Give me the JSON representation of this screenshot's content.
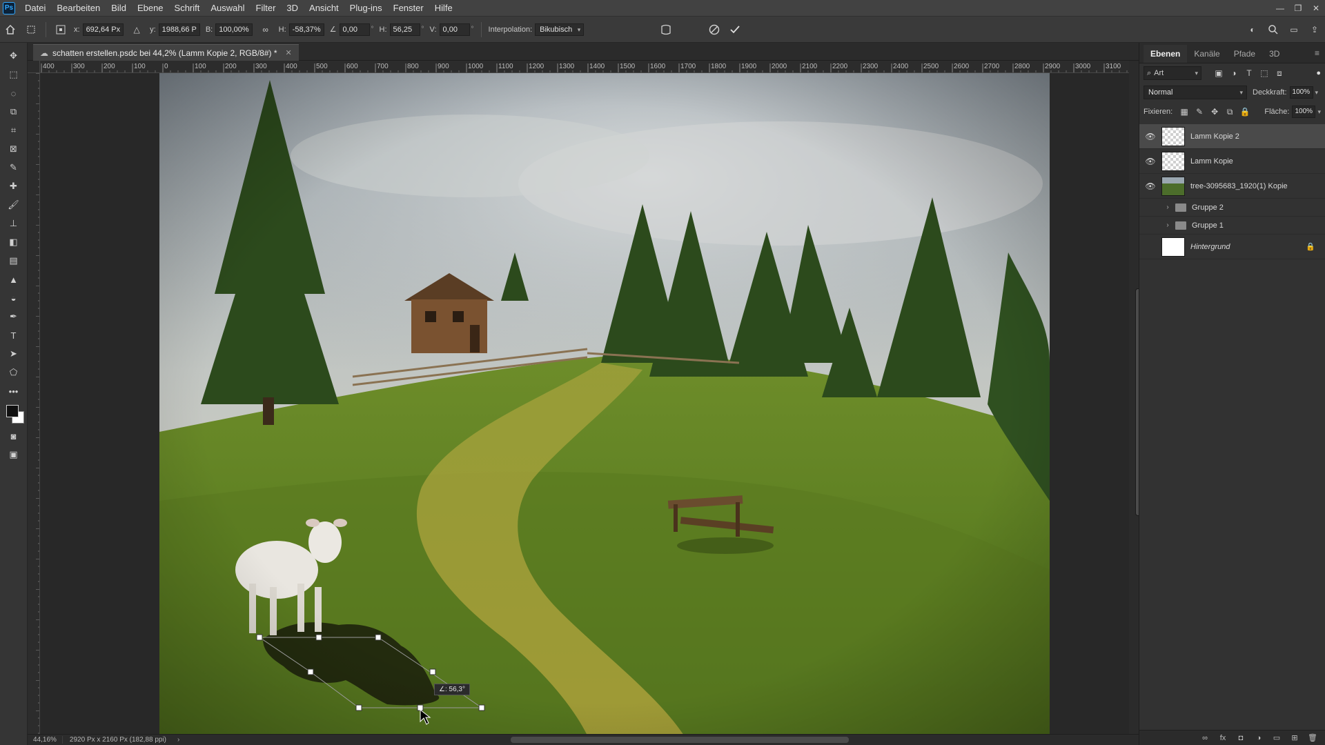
{
  "menubar": {
    "logo": "Ps",
    "items": [
      "Datei",
      "Bearbeiten",
      "Bild",
      "Ebene",
      "Schrift",
      "Auswahl",
      "Filter",
      "3D",
      "Ansicht",
      "Plug-ins",
      "Fenster",
      "Hilfe"
    ]
  },
  "options": {
    "x_label": "x:",
    "x_value": "692,64 Px",
    "y_label": "y:",
    "y_value": "1988,66 P",
    "w_label": "B:",
    "w_value": "100,00%",
    "h_label": "H:",
    "h_value": "-58,37%",
    "angle_value": "0,00",
    "hskew_label": "H:",
    "hskew_value": "56,25",
    "vskew_label": "V:",
    "vskew_value": "0,00",
    "interp_label": "Interpolation:",
    "interp_value": "Bikubisch"
  },
  "document": {
    "tab_title": "schatten erstellen.psdc bei 44,2% (Lamm Kopie 2, RGB/8#) *",
    "angle_readout": "∠: 56,3°"
  },
  "ruler": {
    "top_labels": [
      "400",
      "300",
      "200",
      "100",
      "0",
      "100",
      "200",
      "300",
      "400",
      "500",
      "600",
      "700",
      "800",
      "900",
      "1000",
      "1100",
      "1200",
      "1300",
      "1400",
      "1500",
      "1600",
      "1700",
      "1800",
      "1900",
      "2000",
      "2100",
      "2200",
      "2300",
      "2400",
      "2500",
      "2600",
      "2700",
      "2800",
      "2900",
      "3000",
      "3100"
    ]
  },
  "status": {
    "zoom": "44,16%",
    "docinfo": "2920 Px x 2160 Px (182,88 ppi)"
  },
  "panels": {
    "tabs": [
      "Ebenen",
      "Kanäle",
      "Pfade",
      "3D"
    ],
    "search_value": "Art",
    "blend_mode": "Normal",
    "opacity_label": "Deckkraft:",
    "opacity_value": "100%",
    "lock_label": "Fixieren:",
    "fill_label": "Fläche:",
    "fill_value": "100%",
    "layers": [
      {
        "name": "Lamm Kopie 2",
        "visible": true,
        "selected": true
      },
      {
        "name": "Lamm Kopie",
        "visible": true,
        "selected": false
      },
      {
        "name": "tree-3095683_1920(1) Kopie",
        "visible": true,
        "selected": false
      },
      {
        "name": "Gruppe 2",
        "visible": false,
        "selected": false
      },
      {
        "name": "Gruppe 1",
        "visible": false,
        "selected": false
      },
      {
        "name": "Hintergrund",
        "visible": false,
        "selected": false
      }
    ]
  },
  "colors": {
    "accent": "#31a8ff",
    "panel_bg": "#323232",
    "canvas_bg": "#282828"
  },
  "icons": [
    "home-icon",
    "move-tool-icon",
    "marquee-tool-icon",
    "lasso-tool-icon",
    "crop-tool-icon",
    "eyedropper-tool-icon",
    "brush-tool-icon",
    "eraser-tool-icon",
    "pen-tool-icon",
    "type-tool-icon",
    "eye-icon",
    "lock-icon",
    "folder-icon",
    "cancel-icon",
    "commit-icon",
    "search-icon"
  ]
}
